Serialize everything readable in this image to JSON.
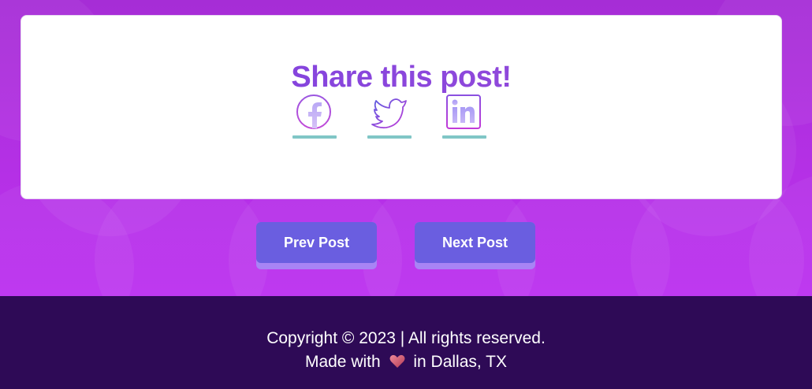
{
  "share": {
    "title": "Share this post!",
    "buttons": [
      {
        "icon": "facebook-icon",
        "label": "Facebook"
      },
      {
        "icon": "twitter-icon",
        "label": "Twitter"
      },
      {
        "icon": "linkedin-icon",
        "label": "LinkedIn"
      }
    ]
  },
  "nav": {
    "prev_label": "Prev Post",
    "next_label": "Next Post"
  },
  "footer": {
    "copyright": "Copyright © 2023 | All rights reserved.",
    "made_with_prefix": "Made with",
    "made_with_icon": "heart-icon",
    "made_with_suffix": "in Dallas, TX"
  },
  "colors": {
    "background": "#b530e6",
    "card": "#ffffff",
    "title_gradient_start": "#7a3fe0",
    "button": "#6a5ee0",
    "button_shadow": "#a884f5",
    "underline": "#80c6c6",
    "footer": "#2e0a56"
  }
}
